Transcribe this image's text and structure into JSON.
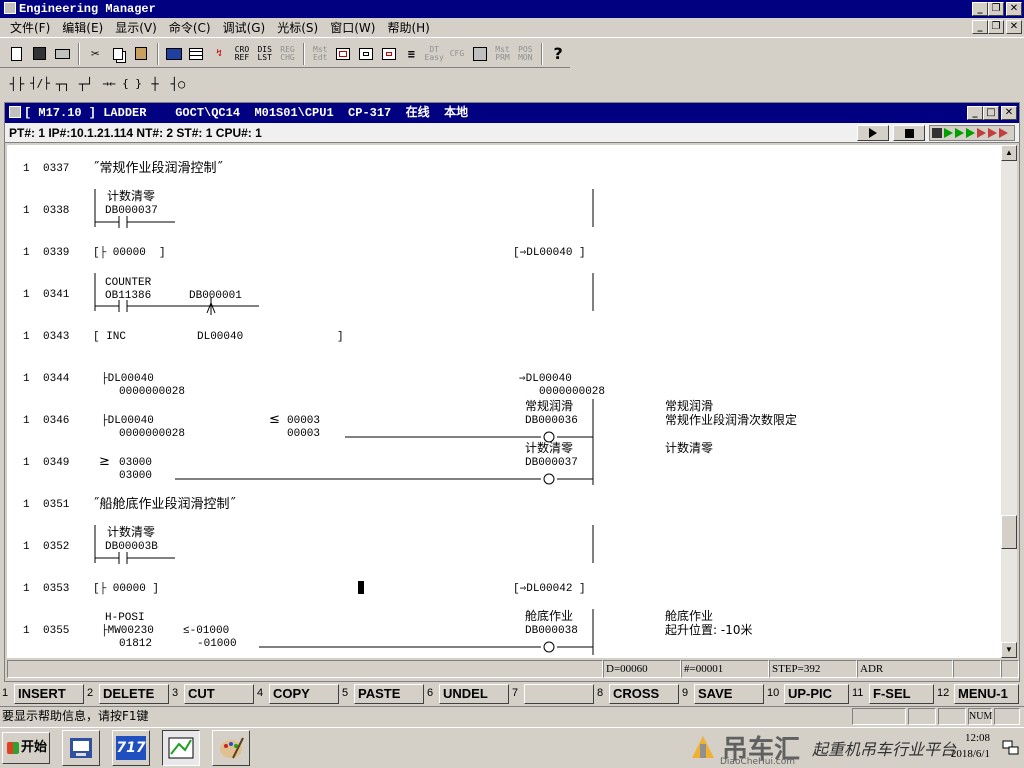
{
  "app": {
    "title": "Engineering Manager"
  },
  "menu": [
    "文件(F)",
    "编辑(E)",
    "显示(V)",
    "命令(C)",
    "调试(G)",
    "光标(S)",
    "窗口(W)",
    "帮助(H)"
  ],
  "toolbar1": {
    "cro_ref": "CRO REF",
    "dis_lst": "DIS LST",
    "reg_chg": "REG CHG",
    "mst_edt": "Mst Edt",
    "dt_easy": "DT Easy",
    "cfg": "CFG",
    "mst_prm": "Mst PRM",
    "pos_mon": "POS MON",
    "help": "?"
  },
  "toolbar2": {
    "contacts": [
      "┤├",
      "┤/├",
      "┬┐",
      "┬┘",
      "→←",
      "{ }",
      "┼",
      "┤○"
    ]
  },
  "inner_window": {
    "title": "[ M17.10 ] LADDER    GOCT\\QC14  M01S01\\CPU1  CP-317  在线  本地",
    "status": "PT#: 1 IP#:10.1.21.114 NT#: 2 ST#: 1 CPU#: 1"
  },
  "ladder": {
    "rows": [
      {
        "num": "1",
        "step": "0337"
      },
      {
        "num": "1",
        "step": "0338"
      },
      {
        "num": "1",
        "step": "0339"
      },
      {
        "num": "1",
        "step": "0341"
      },
      {
        "num": "1",
        "step": "0343"
      },
      {
        "num": "1",
        "step": "0344"
      },
      {
        "num": "1",
        "step": "0346"
      },
      {
        "num": "1",
        "step": "0349"
      },
      {
        "num": "1",
        "step": "0351"
      },
      {
        "num": "1",
        "step": "0352"
      },
      {
        "num": "1",
        "step": "0353"
      },
      {
        "num": "1",
        "step": "0355"
      }
    ],
    "comment_0337": "˝常规作业段润滑控制˝",
    "comment_0351": "˝船舱底作业段润滑控制˝",
    "c_jsql": "计数清零",
    "db37": "DB000037",
    "set_00000": "[├ 00000  ]",
    "out_dl40": "[⇒DL00040 ]",
    "counter": "COUNTER",
    "ob11386": "OB11386",
    "db01": "DB000001",
    "inc": "[ INC",
    "inc_dl40": "DL00040",
    "inc_close": "]",
    "dl40_in": "├DL00040",
    "val28": "0000000028",
    "store_dl40": "⇒DL00040",
    "le_sym": "≤",
    "v00003": "00003",
    "c_cgrh": "常规润滑",
    "db36": "DB000036",
    "ge_sym": "≥",
    "v03000": "03000",
    "db3b": "DB00003B",
    "out_dl42": "[⇒DL00042 ]",
    "hposi": "H-POSI",
    "mw230": "├MW00230",
    "v01812": "01812",
    "le_01000": "≤-01000",
    "v_01000": "-01000",
    "c_cdzy": "舱底作业",
    "db38": "DB000038",
    "cm_346a": "常规润滑",
    "cm_346b": "常规作业段润滑次数限定",
    "cm_349": "计数清零",
    "cm_355a": "舱底作业",
    "cm_355b": "起升位置: -10米"
  },
  "infobar": {
    "d": "D=00060",
    "hash": "#=00001",
    "step": "STEP=392",
    "adr": "ADR"
  },
  "fkeys": [
    {
      "num": "1",
      "label": "INSERT"
    },
    {
      "num": "2",
      "label": "DELETE"
    },
    {
      "num": "3",
      "label": "CUT"
    },
    {
      "num": "4",
      "label": "COPY"
    },
    {
      "num": "5",
      "label": "PASTE"
    },
    {
      "num": "6",
      "label": "UNDEL"
    },
    {
      "num": "7",
      "label": ""
    },
    {
      "num": "8",
      "label": "CROSS"
    },
    {
      "num": "9",
      "label": "SAVE"
    },
    {
      "num": "10",
      "label": "UP-PIC"
    },
    {
      "num": "11",
      "label": "F-SEL"
    },
    {
      "num": "12",
      "label": "MENU-1"
    }
  ],
  "statusbar": {
    "help": "要显示帮助信息，请按F1键",
    "num": "NUM"
  },
  "taskbar": {
    "start": "开始",
    "task2": "717",
    "wm_logo": "吊车汇",
    "wm_sub": "DiaoCheHui.com",
    "wm_slogan": "起重机吊车行业平台",
    "time": "12:08",
    "date": "2018/6/1"
  }
}
